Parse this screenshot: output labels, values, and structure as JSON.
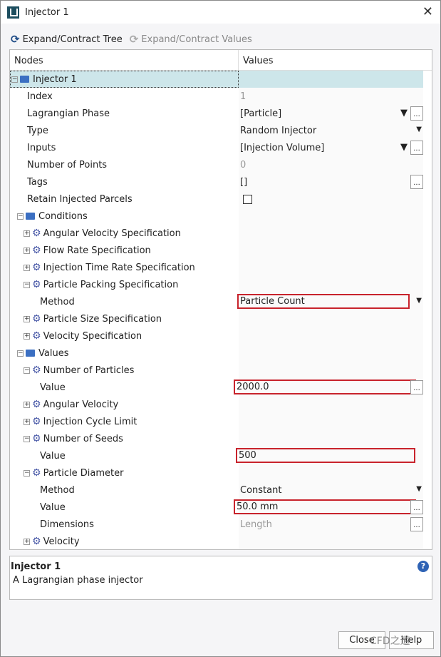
{
  "window": {
    "title": "Injector 1",
    "close_glyph": "✕"
  },
  "toolbar": {
    "expand_tree": "Expand/Contract Tree",
    "expand_values": "Expand/Contract Values"
  },
  "table": {
    "col_nodes": "Nodes",
    "col_values": "Values",
    "rows": [
      {
        "label": "Injector 1",
        "depth": 0,
        "node": "folder",
        "state": "expanded",
        "selected": true
      },
      {
        "label": "Index",
        "depth": 1,
        "value": "1",
        "kind": "readonly"
      },
      {
        "label": "Lagrangian Phase",
        "depth": 1,
        "value": "[Particle]",
        "kind": "filter-dots"
      },
      {
        "label": "Type",
        "depth": 1,
        "value": "Random Injector",
        "kind": "dropdown"
      },
      {
        "label": "Inputs",
        "depth": 1,
        "value": "[Injection Volume]",
        "kind": "filter-dots"
      },
      {
        "label": "Number of Points",
        "depth": 1,
        "value": "0",
        "kind": "readonly"
      },
      {
        "label": "Tags",
        "depth": 1,
        "value": "[]",
        "kind": "dots"
      },
      {
        "label": "Retain Injected Parcels",
        "depth": 1,
        "value": "",
        "kind": "checkbox",
        "checked": false
      },
      {
        "label": "Conditions",
        "depth": 1,
        "node": "folder",
        "state": "expanded"
      },
      {
        "label": "Angular Velocity Specification",
        "depth": 2,
        "node": "gear",
        "state": "collapsed"
      },
      {
        "label": "Flow Rate Specification",
        "depth": 2,
        "node": "gear",
        "state": "collapsed"
      },
      {
        "label": "Injection Time Rate Specification",
        "depth": 2,
        "node": "gear",
        "state": "collapsed"
      },
      {
        "label": "Particle Packing Specification",
        "depth": 2,
        "node": "gear",
        "state": "expanded"
      },
      {
        "label": "Method",
        "depth": 3,
        "value": "Particle Count",
        "kind": "dropdown",
        "highlight": true
      },
      {
        "label": "Particle Size Specification",
        "depth": 2,
        "node": "gear",
        "state": "collapsed"
      },
      {
        "label": "Velocity Specification",
        "depth": 2,
        "node": "gear",
        "state": "collapsed"
      },
      {
        "label": "Values",
        "depth": 1,
        "node": "folder",
        "state": "expanded"
      },
      {
        "label": "Number of Particles",
        "depth": 2,
        "node": "gear",
        "state": "expanded"
      },
      {
        "label": "Value",
        "depth": 3,
        "value": "2000.0",
        "kind": "dots",
        "highlight": true
      },
      {
        "label": "Angular Velocity",
        "depth": 2,
        "node": "gear",
        "state": "collapsed"
      },
      {
        "label": "Injection Cycle Limit",
        "depth": 2,
        "node": "gear",
        "state": "collapsed"
      },
      {
        "label": "Number of Seeds",
        "depth": 2,
        "node": "gear",
        "state": "expanded"
      },
      {
        "label": "Value",
        "depth": 3,
        "value": "500",
        "kind": "text",
        "highlight": true
      },
      {
        "label": "Particle Diameter",
        "depth": 2,
        "node": "gear",
        "state": "expanded"
      },
      {
        "label": "Method",
        "depth": 3,
        "value": "Constant",
        "kind": "dropdown"
      },
      {
        "label": "Value",
        "depth": 3,
        "value": "50.0 mm",
        "kind": "dots",
        "highlight": true
      },
      {
        "label": "Dimensions",
        "depth": 3,
        "value": "Length",
        "kind": "readonly-dots"
      },
      {
        "label": "Velocity",
        "depth": 2,
        "node": "gear",
        "state": "collapsed"
      }
    ]
  },
  "description": {
    "title": "Injector 1",
    "text": "A Lagrangian phase injector"
  },
  "buttons": {
    "close": "Close",
    "help": "Help"
  },
  "watermark": "CFD之道",
  "colors": {
    "highlight": "#c8232c",
    "selected_row": "#cde6ea"
  }
}
